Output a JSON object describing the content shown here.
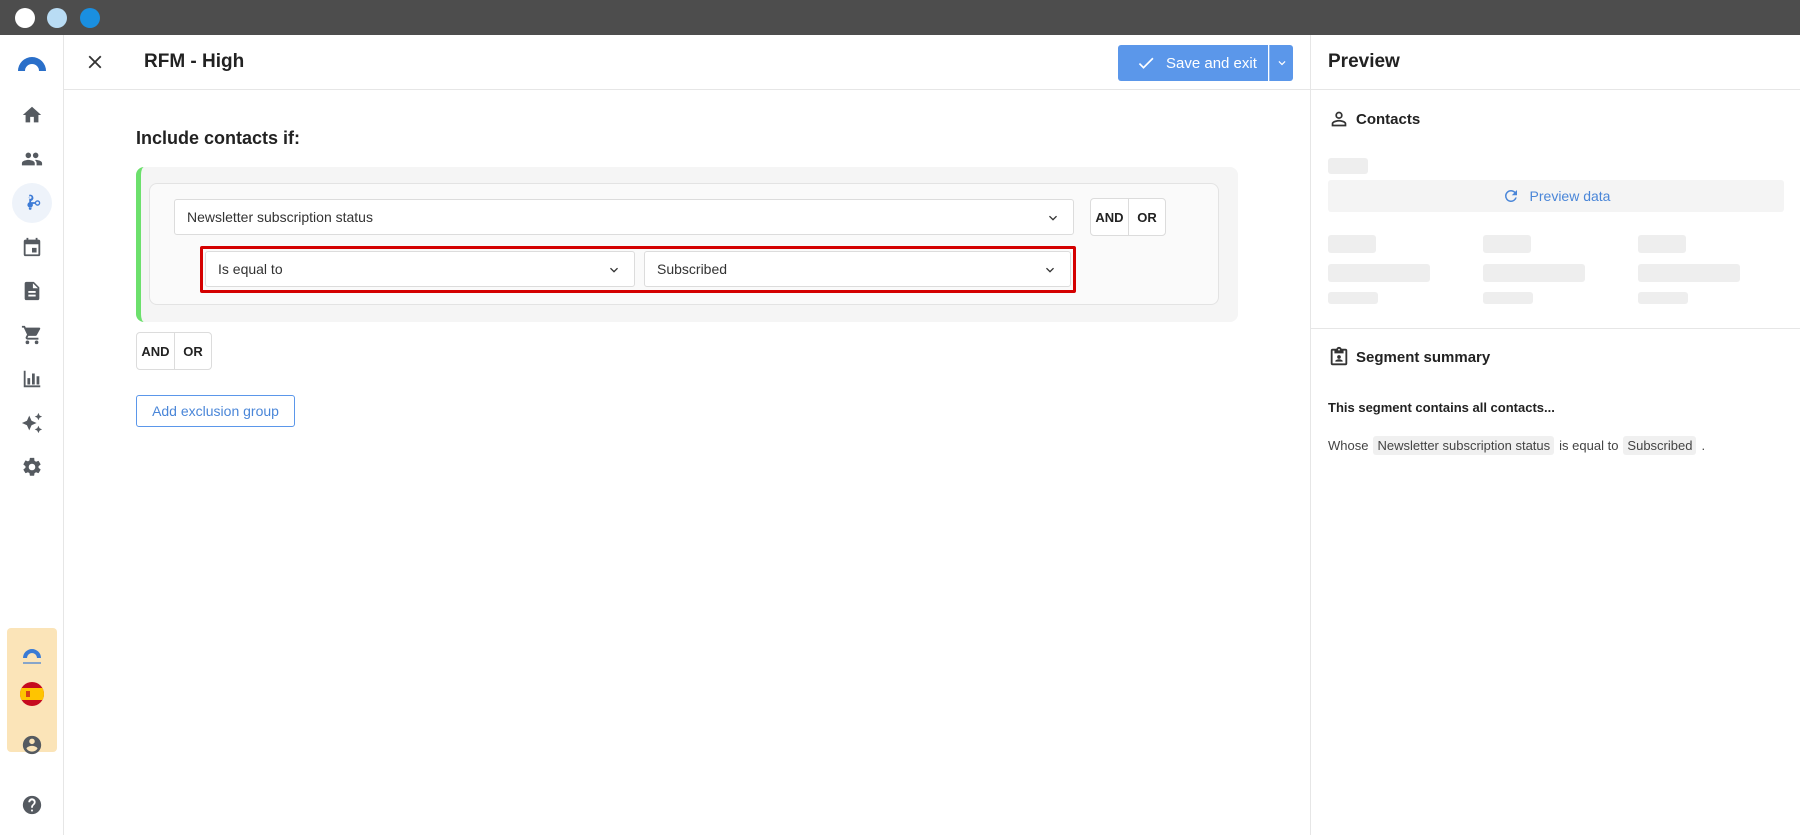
{
  "window": {
    "controls": [
      "close",
      "minimize",
      "maximize"
    ]
  },
  "sidebar": {
    "items": [
      {
        "icon": "home-icon"
      },
      {
        "icon": "people-icon"
      },
      {
        "icon": "segments-icon",
        "active": true
      },
      {
        "icon": "calendar-icon"
      },
      {
        "icon": "document-icon"
      },
      {
        "icon": "cart-icon"
      },
      {
        "icon": "bar-chart-icon"
      },
      {
        "icon": "sparkle-icon"
      },
      {
        "icon": "gear-icon"
      }
    ],
    "bottom": [
      {
        "icon": "account-icon"
      },
      {
        "icon": "help-icon"
      }
    ]
  },
  "header": {
    "title": "RFM - High",
    "save_label": "Save and exit"
  },
  "editor": {
    "section_title": "Include contacts if:",
    "field_value": "Newsletter subscription status",
    "operator_value": "Is equal to",
    "comparison_value": "Subscribed",
    "and_label": "AND",
    "or_label": "OR",
    "exclusion_button": "Add exclusion group"
  },
  "preview": {
    "title": "Preview",
    "contacts_label": "Contacts",
    "preview_data_label": "Preview data",
    "summary_title": "Segment summary",
    "summary_lead": "This segment contains all contacts...",
    "summary": {
      "whose": "Whose",
      "field": "Newsletter subscription status",
      "operator": "is equal to",
      "value": "Subscribed",
      "end": "."
    }
  },
  "colors": {
    "accent": "#5b97ea",
    "group_border": "#6ce06c",
    "highlight": "#d40000"
  }
}
